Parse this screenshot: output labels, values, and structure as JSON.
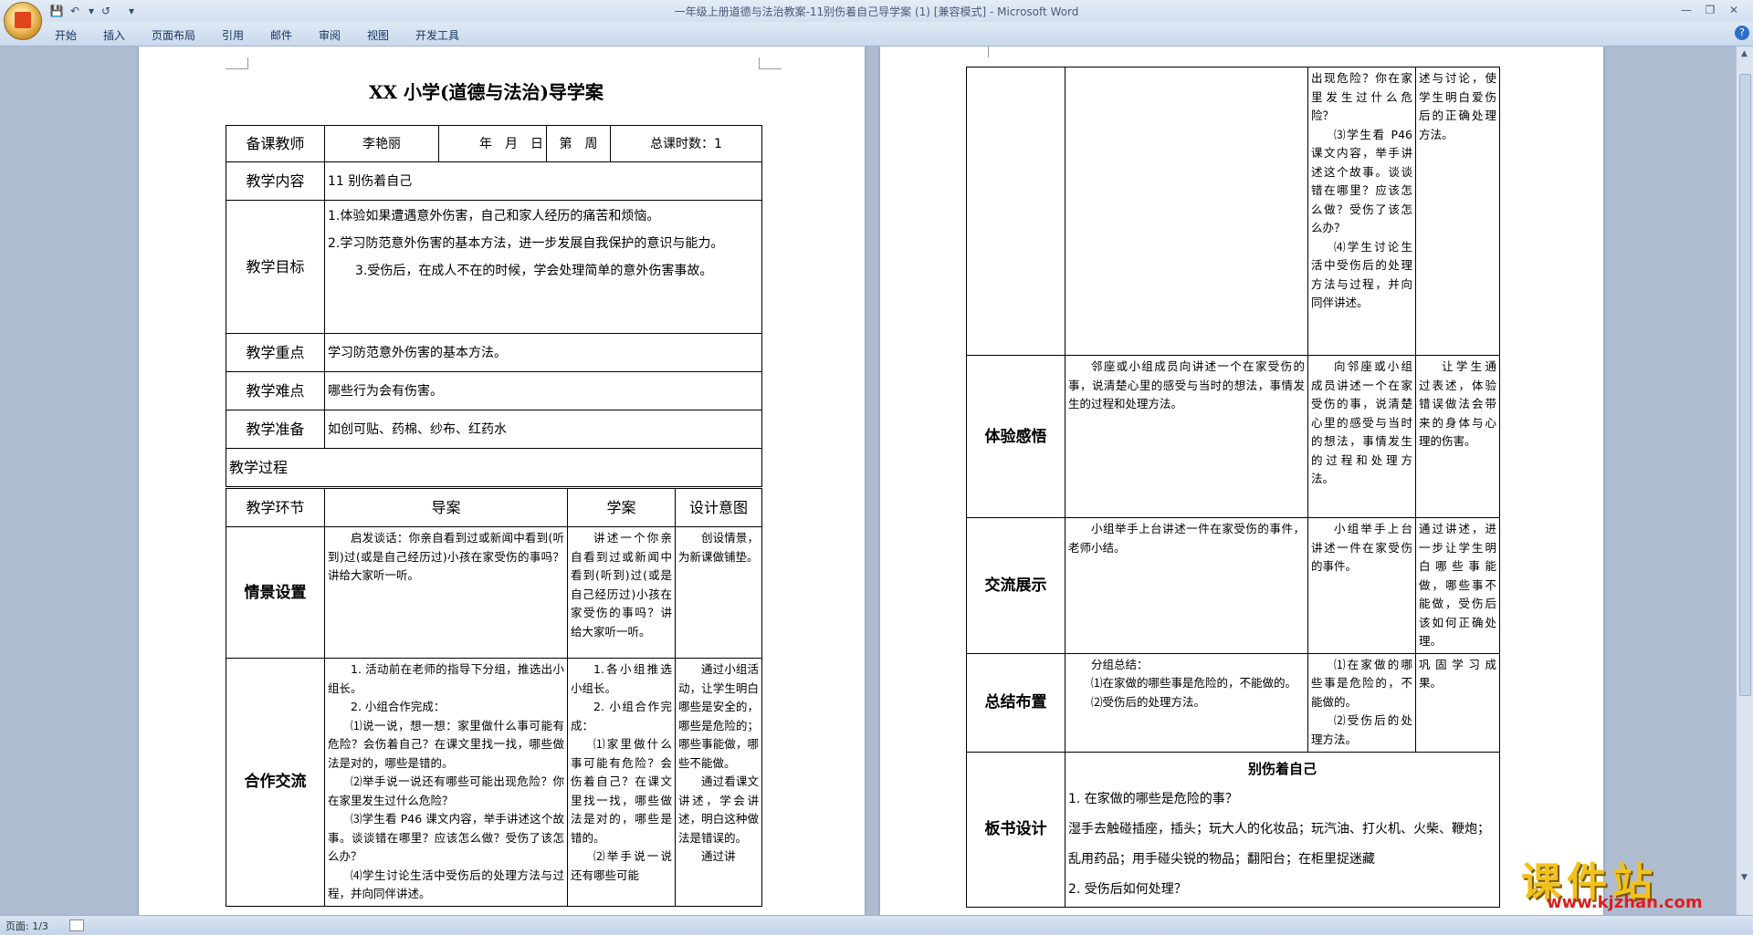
{
  "window": {
    "title": "一年级上册道德与法治教案-11别伤着自己导学案 (1) [兼容模式] - Microsoft Word",
    "ribbon_tabs": [
      "开始",
      "插入",
      "页面布局",
      "引用",
      "邮件",
      "审阅",
      "视图",
      "开发工具"
    ],
    "help": "?"
  },
  "icons": {
    "save": "save-icon",
    "undo": "undo-icon",
    "redo": "redo-icon",
    "customize": "customize-icon"
  },
  "doc": {
    "title": "XX 小学(道德与法治)导学案",
    "header": {
      "teacher_label": "备课教师",
      "teacher_name": "李艳丽",
      "date": "年　月　日",
      "week": "第　周",
      "total_hours": "总课时数：1"
    },
    "content_label": "教学内容",
    "content_value": "11 别伤着自己",
    "goals_label": "教学目标",
    "goals": [
      "1.体验如果遭遇意外伤害，自己和家人经历的痛苦和烦恼。",
      "2.学习防范意外伤害的基本方法，进一步发展自我保护的意识与能力。",
      "3.受伤后，在成人不在的时候，学会处理简单的意外伤害事故。"
    ],
    "key_label": "教学重点",
    "key_value": "学习防范意外伤害的基本方法。",
    "difficulty_label": "教学难点",
    "difficulty_value": "哪些行为会有伤害。",
    "prep_label": "教学准备",
    "prep_value": "如创可贴、药棉、纱布、红药水",
    "process_label": "教学过程",
    "columns": [
      "教学环节",
      "导案",
      "学案",
      "设计意图"
    ],
    "rows": [
      {
        "stage": "情景设置",
        "guide": "启发谈话：你亲自看到过或新闻中看到(听到)过(或是自己经历过)小孩在家受伤的事吗？讲给大家听一听。",
        "study": "讲述一个你亲自看到过或新闻中看到(听到)过(或是自己经历过)小孩在家受伤的事吗？讲给大家听一听。",
        "intent": "创设情景，为新课做铺垫。"
      },
      {
        "stage": "合作交流",
        "guide": [
          "1. 活动前在老师的指导下分组，推选出小组长。",
          "2. 小组合作完成：",
          "⑴说一说，想一想：家里做什么事可能有危险？会伤着自己？在课文里找一找，哪些做法是对的，哪些是错的。",
          "⑵举手说一说还有哪些可能出现危险？你在家里发生过什么危险？",
          "⑶学生看 P46 课文内容，举手讲述这个故事。谈谈错在哪里？应该怎么做？受伤了该怎么办？",
          "⑷学生讨论生活中受伤后的处理方法与过程，并向同伴讲述。"
        ],
        "study": [
          "1.各小组推选小组长。",
          "2. 小组合作完成：",
          "⑴家里做什么事可能有危险？会伤着自己？在课文里找一找，哪些做法是对的，哪些是错的。",
          "⑵举手说一说还有哪些可能"
        ],
        "intent": [
          "通过小组活动，让学生明白哪些是安全的，哪些是危险的；哪些事能做，哪些不能做。",
          "通过看课文讲述，学会讲述，明白这种做法是错误的。",
          "通过讲"
        ]
      }
    ],
    "page2": {
      "row_cont": {
        "study": [
          "出现危险？你在家里发生过什么危险？",
          "⑶学生看 P46 课文内容，举手讲述这个故事。谈谈错在哪里？应该怎么做？受伤了该怎么办？",
          "⑷学生讨论生活中受伤后的处理方法与过程，并向同伴讲述。"
        ],
        "intent": "述与讨论，使学生明白爱伤后的正确处理方法。"
      },
      "rows": [
        {
          "stage": "体验感悟",
          "guide": "邻座或小组成员向讲述一个在家受伤的事，说清楚心里的感受与当时的想法，事情发生的过程和处理方法。",
          "study": "向邻座或小组成员讲述一个在家受伤的事，说清楚心里的感受与当时的想法，事情发生的过程和处理方法。",
          "intent": "让学生通过表述，体验错误做法会带来的身体与心理的伤害。"
        },
        {
          "stage": "交流展示",
          "guide": "小组举手上台讲述一件在家受伤的事件，老师小结。",
          "study": "小组举手上台讲述一件在家受伤的事件。",
          "intent": "通过讲述，进一步让学生明白哪些事能做，哪些事不能做，受伤后该如何正确处理。"
        },
        {
          "stage": "总结布置",
          "guide": [
            "分组总结：",
            "⑴在家做的哪些事是危险的，不能做的。",
            "⑵受伤后的处理方法。"
          ],
          "study": [
            "⑴在家做的哪些事是危险的，不能做的。",
            "⑵受伤后的处理方法。"
          ],
          "intent": "巩固学习成果。"
        }
      ],
      "board": {
        "stage": "板书设计",
        "title": "别伤着自己",
        "lines": [
          "1. 在家做的哪些是危险的事？",
          "湿手去触碰插座，插头；玩大人的化妆品；玩汽油、打火机、火柴、鞭炮；乱用药品；用手碰尖锐的物品；翻阳台；在柜里捉迷藏",
          "2. 受伤后如何处理？"
        ]
      }
    }
  },
  "status": {
    "page": "页面: 1/3"
  },
  "watermark": {
    "cn": "课件站",
    "url": "www.kjzhan.com"
  }
}
